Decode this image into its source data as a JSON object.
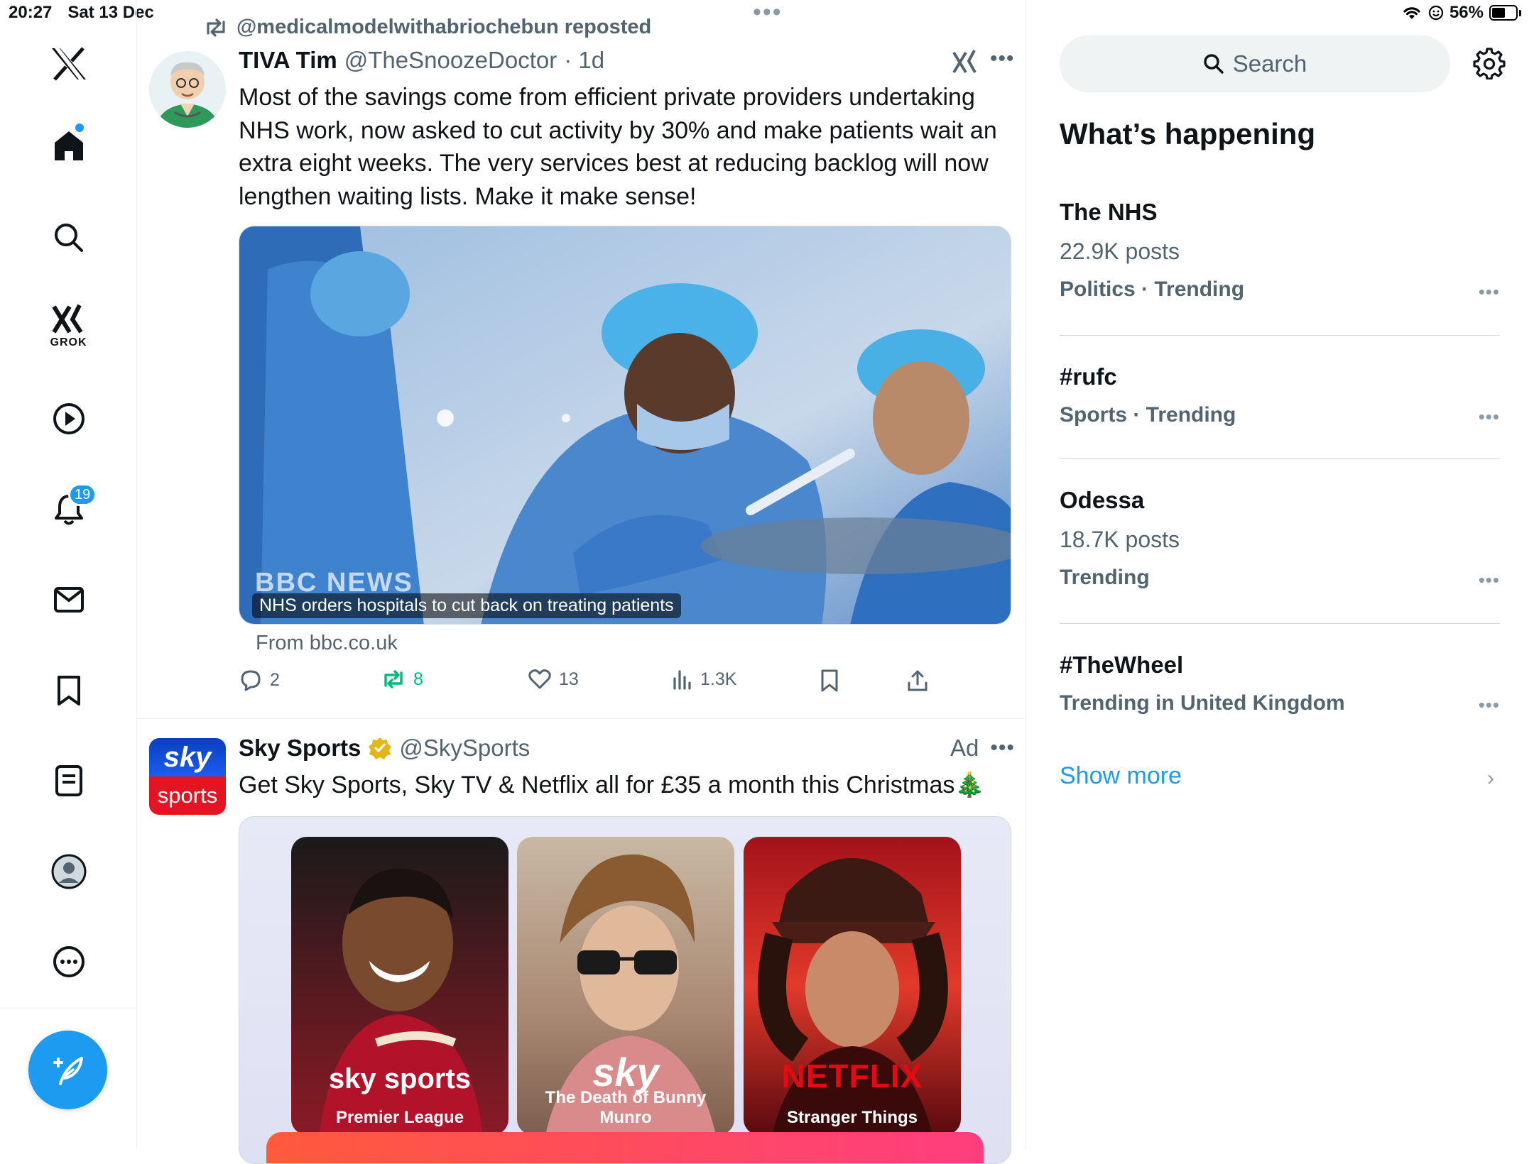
{
  "status_bar": {
    "time": "20:27",
    "date": "Sat 13 Dec",
    "battery_percent": "56%",
    "battery_level": 0.56
  },
  "nav": {
    "grok_label": "GROK",
    "notification_count": "19"
  },
  "repost": {
    "text": "@medicalmodelwithabriochebun reposted"
  },
  "tweet": {
    "author_name": "TIVA Tim",
    "author_handle": "@TheSnoozeDoctor",
    "time": "· 1d",
    "text": "Most of the savings come from efficient private providers undertaking NHS work, now asked to cut activity by 30% and make patients wait an extra eight weeks. The very services best at reducing backlog will now lengthen waiting lists. Make it make sense!",
    "card": {
      "brand": "BBC NEWS",
      "headline": "NHS orders hospitals to cut back on treating patients",
      "source": "From bbc.co.uk"
    },
    "stats": {
      "replies": "2",
      "reposts": "8",
      "likes": "13",
      "views": "1.3K"
    }
  },
  "ad": {
    "author_name": "Sky Sports",
    "author_handle": "@SkySports",
    "ad_label": "Ad",
    "text": "Get Sky Sports, Sky TV & Netflix all for £35 a month this Christmas🎄",
    "avatar_top": "sky",
    "avatar_bottom": "sports",
    "posters": [
      {
        "logo": "sky sports",
        "label": "Premier League"
      },
      {
        "logo": "sky",
        "label": "The Death of Bunny Munro"
      },
      {
        "logo": "NETFLIX",
        "label": "Stranger Things"
      }
    ]
  },
  "sidebar": {
    "search_placeholder": "Search",
    "section_title": "What’s happening",
    "trends": [
      {
        "title": "The NHS",
        "posts": "22.9K posts",
        "meta": "Politics · Trending"
      },
      {
        "title": "#rufc",
        "posts": "",
        "meta": "Sports · Trending"
      },
      {
        "title": "Odessa",
        "posts": "18.7K posts",
        "meta": "Trending"
      },
      {
        "title": "#TheWheel",
        "posts": "",
        "meta": "Trending in United Kingdom"
      }
    ],
    "show_more": "Show more"
  },
  "colors": {
    "accent": "#1d9bf0",
    "repost_green": "#00ba7c",
    "muted_text": "#536471"
  }
}
